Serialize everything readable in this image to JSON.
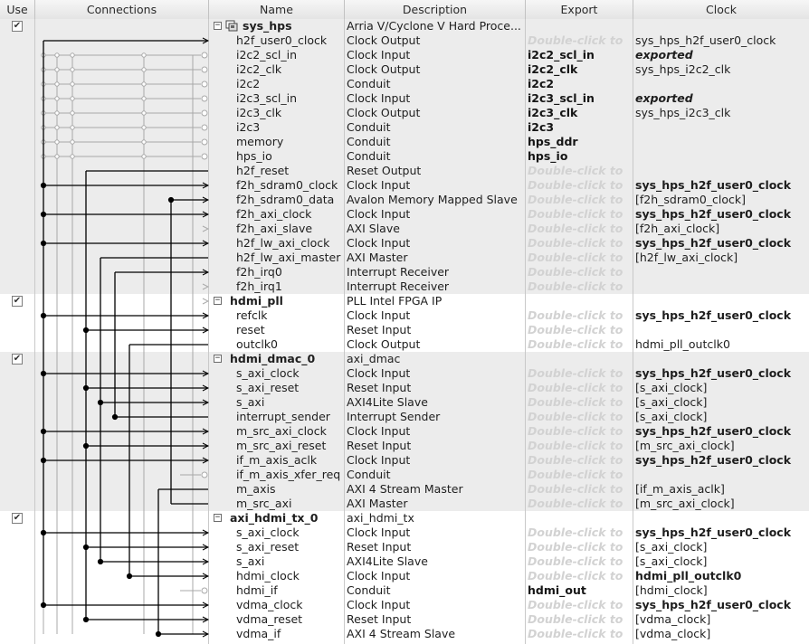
{
  "columns": {
    "use": "Use",
    "connections": "Connections",
    "name": "Name",
    "description": "Description",
    "export": "Export",
    "clock": "Clock"
  },
  "rows": [
    {
      "kind": "component",
      "checked": true,
      "name": "sys_hps",
      "icon": "hps-system-icon",
      "description": "Arria V/Cyclone V Hard Proce...",
      "export": "",
      "export_style": "",
      "clock": "",
      "clock_style": "",
      "shade": true
    },
    {
      "kind": "port",
      "name": "h2f_user0_clock",
      "description": "Clock Output",
      "export": "Double-click to",
      "export_style": "hint",
      "clock": "sys_hps_h2f_user0_clock",
      "clock_style": "normal",
      "shade": true
    },
    {
      "kind": "port",
      "name": "i2c2_scl_in",
      "description": "Clock Input",
      "export": "i2c2_scl_in",
      "export_style": "bold",
      "clock": "exported",
      "clock_style": "italic",
      "shade": true
    },
    {
      "kind": "port",
      "name": "i2c2_clk",
      "description": "Clock Output",
      "export": "i2c2_clk",
      "export_style": "bold",
      "clock": "sys_hps_i2c2_clk",
      "clock_style": "normal",
      "shade": true
    },
    {
      "kind": "port",
      "name": "i2c2",
      "description": "Conduit",
      "export": "i2c2",
      "export_style": "bold",
      "clock": "",
      "clock_style": "",
      "shade": true
    },
    {
      "kind": "port",
      "name": "i2c3_scl_in",
      "description": "Clock Input",
      "export": "i2c3_scl_in",
      "export_style": "bold",
      "clock": "exported",
      "clock_style": "italic",
      "shade": true
    },
    {
      "kind": "port",
      "name": "i2c3_clk",
      "description": "Clock Output",
      "export": "i2c3_clk",
      "export_style": "bold",
      "clock": "sys_hps_i2c3_clk",
      "clock_style": "normal",
      "shade": true
    },
    {
      "kind": "port",
      "name": "i2c3",
      "description": "Conduit",
      "export": "i2c3",
      "export_style": "bold",
      "clock": "",
      "clock_style": "",
      "shade": true
    },
    {
      "kind": "port",
      "name": "memory",
      "description": "Conduit",
      "export": "hps_ddr",
      "export_style": "bold",
      "clock": "",
      "clock_style": "",
      "shade": true
    },
    {
      "kind": "port",
      "name": "hps_io",
      "description": "Conduit",
      "export": "hps_io",
      "export_style": "bold",
      "clock": "",
      "clock_style": "",
      "shade": true
    },
    {
      "kind": "port",
      "name": "h2f_reset",
      "description": "Reset Output",
      "export": "Double-click to",
      "export_style": "hint",
      "clock": "",
      "clock_style": "",
      "shade": true
    },
    {
      "kind": "port",
      "name": "f2h_sdram0_clock",
      "description": "Clock Input",
      "export": "Double-click to",
      "export_style": "hint",
      "clock": "sys_hps_h2f_user0_clock",
      "clock_style": "bold",
      "shade": true
    },
    {
      "kind": "port",
      "name": "f2h_sdram0_data",
      "description": "Avalon Memory Mapped Slave",
      "export": "Double-click to",
      "export_style": "hint",
      "clock": "[f2h_sdram0_clock]",
      "clock_style": "normal",
      "shade": true
    },
    {
      "kind": "port",
      "name": "f2h_axi_clock",
      "description": "Clock Input",
      "export": "Double-click to",
      "export_style": "hint",
      "clock": "sys_hps_h2f_user0_clock",
      "clock_style": "bold",
      "shade": true
    },
    {
      "kind": "port",
      "name": "f2h_axi_slave",
      "description": "AXI Slave",
      "export": "Double-click to",
      "export_style": "hint",
      "clock": "[f2h_axi_clock]",
      "clock_style": "normal",
      "shade": true
    },
    {
      "kind": "port",
      "name": "h2f_lw_axi_clock",
      "description": "Clock Input",
      "export": "Double-click to",
      "export_style": "hint",
      "clock": "sys_hps_h2f_user0_clock",
      "clock_style": "bold",
      "shade": true
    },
    {
      "kind": "port",
      "name": "h2f_lw_axi_master",
      "description": "AXI Master",
      "export": "Double-click to",
      "export_style": "hint",
      "clock": "[h2f_lw_axi_clock]",
      "clock_style": "normal",
      "shade": true
    },
    {
      "kind": "port",
      "name": "f2h_irq0",
      "description": "Interrupt Receiver",
      "export": "Double-click to",
      "export_style": "hint",
      "clock": "",
      "clock_style": "",
      "shade": true
    },
    {
      "kind": "port",
      "name": "f2h_irq1",
      "description": "Interrupt Receiver",
      "export": "Double-click to",
      "export_style": "hint",
      "clock": "",
      "clock_style": "",
      "shade": true
    },
    {
      "kind": "component",
      "checked": true,
      "name": "hdmi_pll",
      "icon": "",
      "description": "PLL Intel FPGA IP",
      "export": "",
      "export_style": "",
      "clock": "",
      "clock_style": "",
      "shade": false
    },
    {
      "kind": "port",
      "name": "refclk",
      "description": "Clock Input",
      "export": "Double-click to",
      "export_style": "hint",
      "clock": "sys_hps_h2f_user0_clock",
      "clock_style": "bold",
      "shade": false
    },
    {
      "kind": "port",
      "name": "reset",
      "description": "Reset Input",
      "export": "Double-click to",
      "export_style": "hint",
      "clock": "",
      "clock_style": "",
      "shade": false
    },
    {
      "kind": "port",
      "name": "outclk0",
      "description": "Clock Output",
      "export": "Double-click to",
      "export_style": "hint",
      "clock": "hdmi_pll_outclk0",
      "clock_style": "normal",
      "shade": false
    },
    {
      "kind": "component",
      "checked": true,
      "name": "hdmi_dmac_0",
      "icon": "",
      "description": "axi_dmac",
      "export": "",
      "export_style": "",
      "clock": "",
      "clock_style": "",
      "shade": true
    },
    {
      "kind": "port",
      "name": "s_axi_clock",
      "description": "Clock Input",
      "export": "Double-click to",
      "export_style": "hint",
      "clock": "sys_hps_h2f_user0_clock",
      "clock_style": "bold",
      "shade": true
    },
    {
      "kind": "port",
      "name": "s_axi_reset",
      "description": "Reset Input",
      "export": "Double-click to",
      "export_style": "hint",
      "clock": "[s_axi_clock]",
      "clock_style": "normal",
      "shade": true
    },
    {
      "kind": "port",
      "name": "s_axi",
      "description": "AXI4Lite Slave",
      "export": "Double-click to",
      "export_style": "hint",
      "clock": "[s_axi_clock]",
      "clock_style": "normal",
      "shade": true
    },
    {
      "kind": "port",
      "name": "interrupt_sender",
      "description": "Interrupt Sender",
      "export": "Double-click to",
      "export_style": "hint",
      "clock": "[s_axi_clock]",
      "clock_style": "normal",
      "shade": true
    },
    {
      "kind": "port",
      "name": "m_src_axi_clock",
      "description": "Clock Input",
      "export": "Double-click to",
      "export_style": "hint",
      "clock": "sys_hps_h2f_user0_clock",
      "clock_style": "bold",
      "shade": true
    },
    {
      "kind": "port",
      "name": "m_src_axi_reset",
      "description": "Reset Input",
      "export": "Double-click to",
      "export_style": "hint",
      "clock": "[m_src_axi_clock]",
      "clock_style": "normal",
      "shade": true
    },
    {
      "kind": "port",
      "name": "if_m_axis_aclk",
      "description": "Clock Input",
      "export": "Double-click to",
      "export_style": "hint",
      "clock": "sys_hps_h2f_user0_clock",
      "clock_style": "bold",
      "shade": true
    },
    {
      "kind": "port",
      "name": "if_m_axis_xfer_req",
      "description": "Conduit",
      "export": "Double-click to",
      "export_style": "hint",
      "clock": "",
      "clock_style": "",
      "shade": true
    },
    {
      "kind": "port",
      "name": "m_axis",
      "description": "AXI 4 Stream Master",
      "export": "Double-click to",
      "export_style": "hint",
      "clock": "[if_m_axis_aclk]",
      "clock_style": "normal",
      "shade": true
    },
    {
      "kind": "port",
      "name": "m_src_axi",
      "description": "AXI Master",
      "export": "Double-click to",
      "export_style": "hint",
      "clock": "[m_src_axi_clock]",
      "clock_style": "normal",
      "shade": true
    },
    {
      "kind": "component",
      "checked": true,
      "name": "axi_hdmi_tx_0",
      "icon": "",
      "description": "axi_hdmi_tx",
      "export": "",
      "export_style": "",
      "clock": "",
      "clock_style": "",
      "shade": false
    },
    {
      "kind": "port",
      "name": "s_axi_clock",
      "description": "Clock Input",
      "export": "Double-click to",
      "export_style": "hint",
      "clock": "sys_hps_h2f_user0_clock",
      "clock_style": "bold",
      "shade": false
    },
    {
      "kind": "port",
      "name": "s_axi_reset",
      "description": "Reset Input",
      "export": "Double-click to",
      "export_style": "hint",
      "clock": "[s_axi_clock]",
      "clock_style": "normal",
      "shade": false
    },
    {
      "kind": "port",
      "name": "s_axi",
      "description": "AXI4Lite Slave",
      "export": "Double-click to",
      "export_style": "hint",
      "clock": "[s_axi_clock]",
      "clock_style": "normal",
      "shade": false
    },
    {
      "kind": "port",
      "name": "hdmi_clock",
      "description": "Clock Input",
      "export": "Double-click to",
      "export_style": "hint",
      "clock": "hdmi_pll_outclk0",
      "clock_style": "bold",
      "shade": false
    },
    {
      "kind": "port",
      "name": "hdmi_if",
      "description": "Conduit",
      "export": "hdmi_out",
      "export_style": "bold",
      "clock": "[hdmi_clock]",
      "clock_style": "normal",
      "shade": false
    },
    {
      "kind": "port",
      "name": "vdma_clock",
      "description": "Clock Input",
      "export": "Double-click to",
      "export_style": "hint",
      "clock": "sys_hps_h2f_user0_clock",
      "clock_style": "bold",
      "shade": false
    },
    {
      "kind": "port",
      "name": "vdma_reset",
      "description": "Reset Input",
      "export": "Double-click to",
      "export_style": "hint",
      "clock": "[vdma_clock]",
      "clock_style": "normal",
      "shade": false
    },
    {
      "kind": "port",
      "name": "vdma_if",
      "description": "AXI 4 Stream Slave",
      "export": "Double-click to",
      "export_style": "hint",
      "clock": "[vdma_clock]",
      "clock_style": "normal",
      "shade": false
    }
  ],
  "colors": {
    "row_shade": "#ececec",
    "export_hint": "#d2d2d2",
    "connection_active": "#000000",
    "connection_inactive": "#a8a8a8"
  }
}
